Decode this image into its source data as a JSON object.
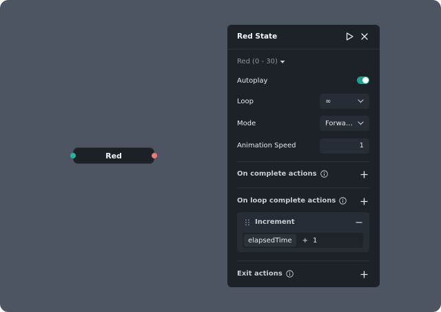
{
  "node": {
    "label": "Red"
  },
  "panel": {
    "title": "Red State",
    "state_select": {
      "label": "Red",
      "range": "(0 - 30)"
    },
    "autoplay": {
      "label": "Autoplay",
      "enabled": true
    },
    "loop": {
      "label": "Loop",
      "value": "∞"
    },
    "mode": {
      "label": "Mode",
      "value": "Forwa…"
    },
    "animation_speed": {
      "label": "Animation Speed",
      "value": "1"
    },
    "sections": {
      "on_complete": "On complete actions",
      "on_loop_complete": "On loop complete actions",
      "exit": "Exit actions"
    },
    "action": {
      "title": "Increment",
      "variable": "elapsedTime",
      "operator": "+",
      "operand": "1"
    }
  },
  "colors": {
    "canvas": "#4c5561",
    "panel": "#1c2228",
    "accent": "#1fa08c",
    "port_in": "#1fb89a",
    "port_out": "#ea7a7a"
  },
  "icons": [
    "play-icon",
    "close-icon",
    "caret-down-icon",
    "chevron-down-icon",
    "info-icon",
    "plus-icon",
    "drag-handle-icon",
    "minus-icon"
  ]
}
